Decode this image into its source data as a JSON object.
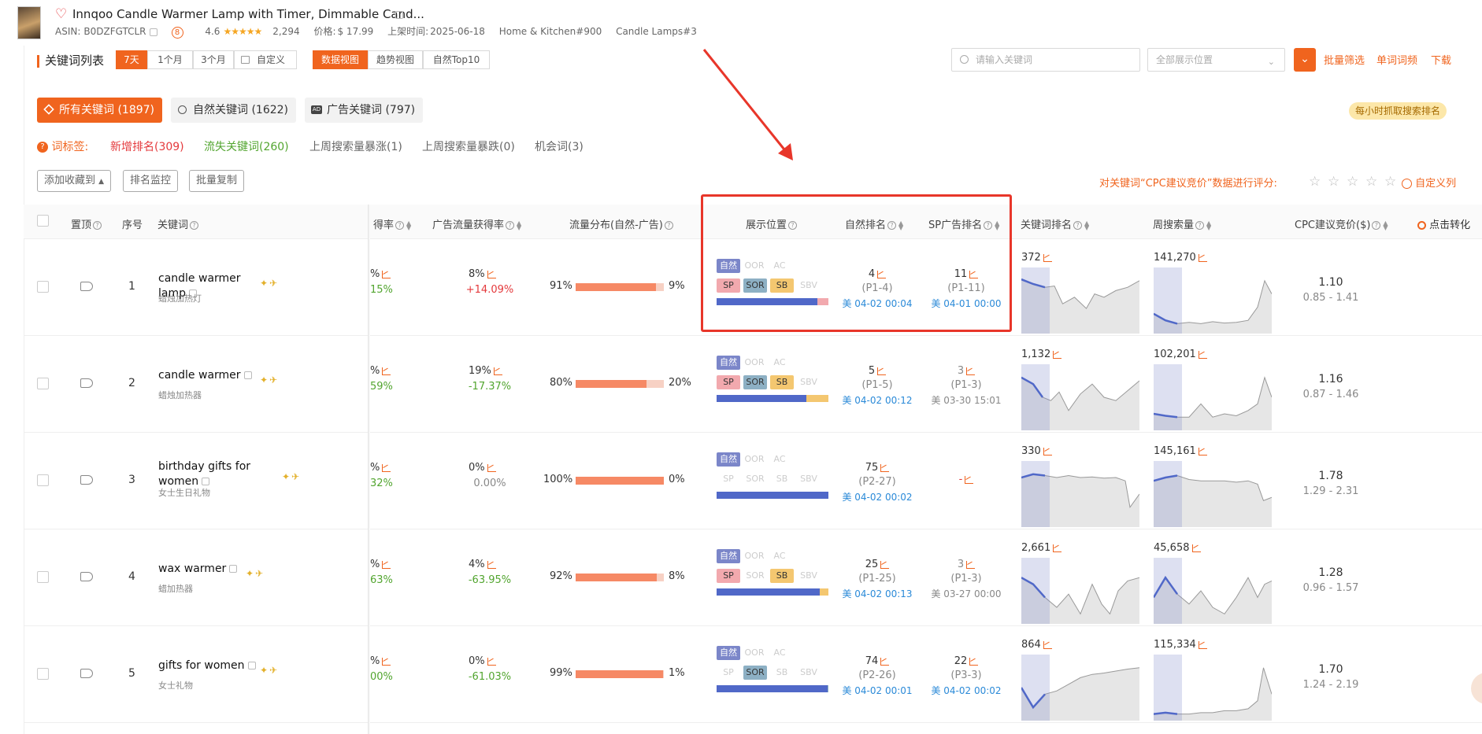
{
  "product": {
    "title": "Innqoo Candle Warmer Lamp with Timer, Dimmable Cand...",
    "asin_label": "ASIN:",
    "asin": "B0DZFGTCLR",
    "badge": "8",
    "rating": "4.6",
    "stars": "★★★★★",
    "reviews": "2,294",
    "price_label": "价格:",
    "price": "$ 17.99",
    "listed_label": "上架时间:",
    "listed": "2025-06-18",
    "rank1": "Home & Kitchen#900",
    "rank2": "Candle Lamps#3"
  },
  "toolbar": {
    "section_title": "关键词列表",
    "periods": [
      "7天",
      "1个月",
      "3个月",
      "自定义"
    ],
    "views": [
      "数据视图",
      "趋势视图",
      "自然Top10"
    ],
    "search_placeholder": "请输入关键词",
    "position_select": "全部展示位置",
    "batch_filter": "批量筛选",
    "word_freq": "单词词频",
    "download": "下载"
  },
  "filters": {
    "all": "所有关键词 (1897)",
    "natural": "自然关键词 (1622)",
    "ad": "广告关键词 (797)",
    "ad_badge": "AD",
    "hourly": "每小时抓取搜索排名"
  },
  "tags": {
    "label": "词标签:",
    "items": [
      "新增排名(309)",
      "流失关键词(260)",
      "上周搜索量暴涨(1)",
      "上周搜索量暴跌(0)",
      "机会词(3)"
    ]
  },
  "actions": {
    "add_collection": "添加收藏到",
    "rank_monitor": "排名监控",
    "batch_copy": "批量复制",
    "rate_text": "对关键词“CPC建议竞价”数据进行评分:",
    "customize": "自定义列"
  },
  "columns": {
    "pin": "置顶",
    "index": "序号",
    "keyword": "关键词",
    "rate": "得率",
    "ad_rate": "广告流量获得率",
    "traffic": "流量分布(自然-广告)",
    "position": "展示位置",
    "natural_rank": "自然排名",
    "sp_rank": "SP广告排名",
    "kw_rank": "关键词排名",
    "weekly_search": "周搜索量",
    "cpc": "CPC建议竞价($)",
    "click": "点击转化"
  },
  "position_labels": {
    "natural": "自然",
    "oor": "OOR",
    "ac": "AC",
    "sp": "SP",
    "sor": "SOR",
    "sb": "SB",
    "sbv": "SBV"
  },
  "rows": [
    {
      "index": "1",
      "keyword": "candle warmer lamp",
      "keyword_cn": "蜡烛加热灯",
      "rate": "%",
      "rate_change": "15%",
      "ad_rate": "8%",
      "ad_change": "+14.09%",
      "ad_change_color": "red",
      "natural_pct": "91%",
      "ad_pct": "9%",
      "natural_share": 0.91,
      "active": {
        "natural": true,
        "oor": false,
        "ac": false,
        "sp": true,
        "sor": true,
        "sb": true,
        "sbv": false
      },
      "pos_bar_natural": 0.9,
      "pos_bar_second": "#f2a9ae",
      "nat_rank": "4",
      "nat_page": "(P1-4)",
      "nat_time": "美 04-02 00:04",
      "sp_rank": "11",
      "sp_page": "(P1-11)",
      "sp_time": "美 04-01 00:00",
      "sp_time_color": "blue",
      "kw_rank": "372",
      "weekly": "141,270",
      "cpc": "1.10",
      "cpc_range": "0.85 - 1.41"
    },
    {
      "index": "2",
      "keyword": "candle warmer",
      "keyword_cn": "蜡烛加热器",
      "rate": "%",
      "rate_change": "59%",
      "ad_rate": "19%",
      "ad_change": "-17.37%",
      "ad_change_color": "green",
      "natural_pct": "80%",
      "ad_pct": "20%",
      "natural_share": 0.8,
      "active": {
        "natural": true,
        "oor": false,
        "ac": false,
        "sp": true,
        "sor": true,
        "sb": true,
        "sbv": false
      },
      "pos_bar_natural": 0.8,
      "pos_bar_second": "#f4c770",
      "nat_rank": "5",
      "nat_page": "(P1-5)",
      "nat_time": "美 04-02 00:12",
      "sp_rank": "3",
      "sp_page": "(P1-3)",
      "sp_time": "美 03-30 15:01",
      "sp_time_color": "grey",
      "kw_rank": "1,132",
      "weekly": "102,201",
      "cpc": "1.16",
      "cpc_range": "0.87 - 1.46"
    },
    {
      "index": "3",
      "keyword": "birthday gifts for women",
      "keyword_cn": "女士生日礼物",
      "rate": "%",
      "rate_change": "32%",
      "ad_rate": "0%",
      "ad_change": "0.00%",
      "ad_change_color": "grey",
      "natural_pct": "100%",
      "ad_pct": "0%",
      "natural_share": 1.0,
      "active": {
        "natural": true,
        "oor": false,
        "ac": false,
        "sp": false,
        "sor": false,
        "sb": false,
        "sbv": false
      },
      "pos_bar_natural": 1.0,
      "pos_bar_second": "#5068c8",
      "nat_rank": "75",
      "nat_page": "(P2-27)",
      "nat_time": "美 04-02 00:02",
      "sp_rank": "-",
      "sp_page": "",
      "sp_time": "",
      "sp_time_color": "grey",
      "kw_rank": "330",
      "weekly": "145,161",
      "cpc": "1.78",
      "cpc_range": "1.29 - 2.31"
    },
    {
      "index": "4",
      "keyword": "wax warmer",
      "keyword_cn": "蜡加热器",
      "rate": "%",
      "rate_change": "63%",
      "ad_rate": "4%",
      "ad_change": "-63.95%",
      "ad_change_color": "green",
      "natural_pct": "92%",
      "ad_pct": "8%",
      "natural_share": 0.92,
      "active": {
        "natural": true,
        "oor": false,
        "ac": false,
        "sp": true,
        "sor": false,
        "sb": true,
        "sbv": false
      },
      "pos_bar_natural": 0.92,
      "pos_bar_second": "#f4c770",
      "nat_rank": "25",
      "nat_page": "(P1-25)",
      "nat_time": "美 04-02 00:13",
      "sp_rank": "3",
      "sp_page": "(P1-3)",
      "sp_time": "美 03-27 00:00",
      "sp_time_color": "grey",
      "kw_rank": "2,661",
      "weekly": "45,658",
      "cpc": "1.28",
      "cpc_range": "0.96 - 1.57"
    },
    {
      "index": "5",
      "keyword": "gifts for women",
      "keyword_cn": "女士礼物",
      "rate": "%",
      "rate_change": "00%",
      "ad_rate": "0%",
      "ad_change": "-61.03%",
      "ad_change_color": "green",
      "natural_pct": "99%",
      "ad_pct": "1%",
      "natural_share": 0.99,
      "active": {
        "natural": true,
        "oor": false,
        "ac": false,
        "sp": false,
        "sor": true,
        "sb": false,
        "sbv": false
      },
      "pos_bar_natural": 0.99,
      "pos_bar_second": "#8db0c4",
      "nat_rank": "74",
      "nat_page": "(P2-26)",
      "nat_time": "美 04-02 00:01",
      "sp_rank": "22",
      "sp_page": "(P3-3)",
      "sp_time": "美 04-02 00:02",
      "sp_time_color": "blue",
      "kw_rank": "864",
      "weekly": "115,334",
      "cpc": "1.70",
      "cpc_range": "1.24 - 2.19"
    }
  ],
  "colors": {
    "accent": "#f0641e",
    "natural_blue": "#5068c8",
    "red_box": "#e8362a"
  }
}
